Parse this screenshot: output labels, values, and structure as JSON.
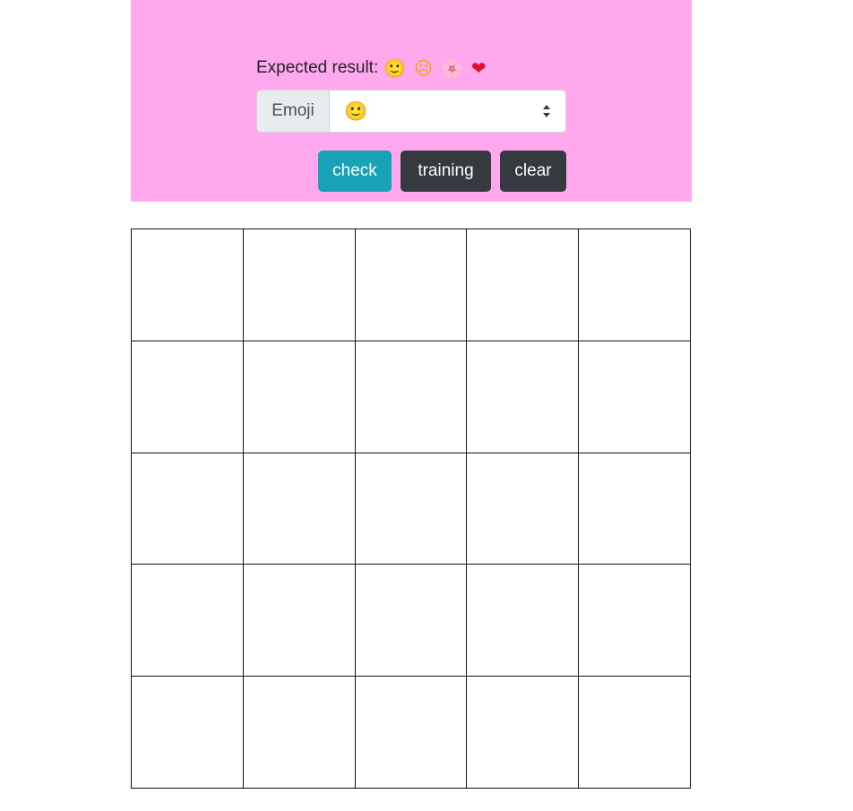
{
  "header": {
    "expected_label": "Expected result:",
    "expected_emojis": [
      "🙂",
      "☹",
      "🌸",
      "❤"
    ]
  },
  "emoji_select": {
    "addon_label": "Emoji",
    "selected_value": "🙂"
  },
  "buttons": {
    "check": "check",
    "training": "training",
    "clear": "clear"
  },
  "grid": {
    "rows": 5,
    "cols": 5
  },
  "colors": {
    "panel_background": "#ffa8ee",
    "check_button": "#17a2b8",
    "dark_button": "#343a40",
    "grid_line": "#111111"
  }
}
